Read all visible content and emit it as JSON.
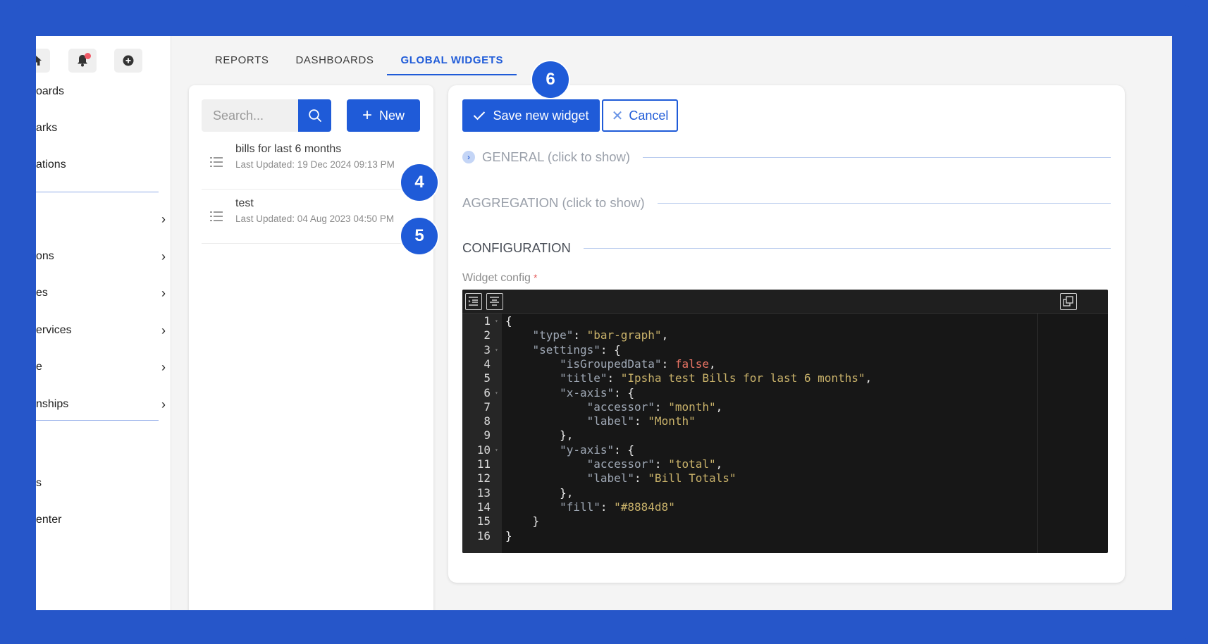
{
  "sidebar": {
    "top_icons": [
      "home-icon",
      "bell-icon",
      "plus-circle-icon"
    ],
    "items": [
      {
        "label": "oards",
        "chevron": false
      },
      {
        "label": "arks",
        "chevron": false
      },
      {
        "label": "ations",
        "chevron": false
      },
      {
        "label": "",
        "chevron": true
      },
      {
        "label": "ons",
        "chevron": true
      },
      {
        "label": "es",
        "chevron": true
      },
      {
        "label": "ervices",
        "chevron": true
      },
      {
        "label": "e",
        "chevron": true
      },
      {
        "label": "nships",
        "chevron": true
      },
      {
        "label": "s",
        "chevron": false
      },
      {
        "label": "enter",
        "chevron": false
      }
    ]
  },
  "tabs": [
    {
      "label": "REPORTS",
      "active": false
    },
    {
      "label": "DASHBOARDS",
      "active": false
    },
    {
      "label": "GLOBAL WIDGETS",
      "active": true
    }
  ],
  "list_panel": {
    "search_placeholder": "Search...",
    "new_label": "New",
    "items": [
      {
        "title": "bills for last 6 months",
        "updated": "Last Updated: 19 Dec 2024 09:13 PM"
      },
      {
        "title": "test",
        "updated": "Last Updated: 04 Aug 2023 04:50 PM"
      }
    ]
  },
  "editor_panel": {
    "save_label": "Save new widget",
    "cancel_label": "Cancel",
    "sections": {
      "general": "GENERAL (click to show)",
      "aggregation": "AGGREGATION (click to show)",
      "configuration": "CONFIGURATION"
    },
    "widget_config_label": "Widget config",
    "required_mark": "*",
    "code_lines": [
      "{",
      "    \"type\": \"bar-graph\",",
      "    \"settings\": {",
      "        \"isGroupedData\": false,",
      "        \"title\": \"Ipsha test Bills for last 6 months\",",
      "        \"x-axis\": {",
      "            \"accessor\": \"month\",",
      "            \"label\": \"Month\"",
      "        },",
      "        \"y-axis\": {",
      "            \"accessor\": \"total\",",
      "            \"label\": \"Bill Totals\"",
      "        },",
      "        \"fill\": \"#8884d8\"",
      "    }",
      "}"
    ],
    "foldable_lines": [
      1,
      3,
      6,
      10
    ]
  },
  "badges": {
    "six": "6",
    "four": "4",
    "five": "5"
  },
  "colors": {
    "accent": "#1f5bd8",
    "frame": "#2656c9",
    "notification_dot": "#f05a67"
  }
}
